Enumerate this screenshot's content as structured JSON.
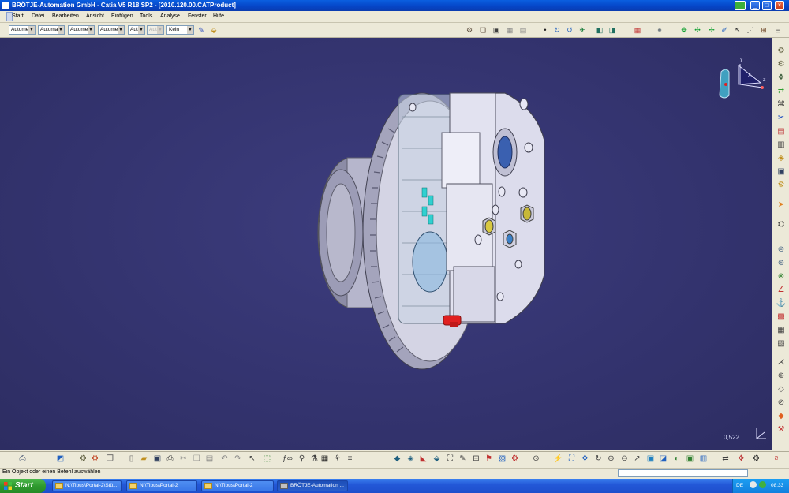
{
  "window": {
    "title": "BRÖTJE-Automation GmbH - Catia V5 R18 SP2 - [2010.120.00.CATProduct]",
    "controls": [
      "_",
      "□",
      "×"
    ]
  },
  "menu": {
    "items": [
      "Start",
      "Datei",
      "Bearbeiten",
      "Ansicht",
      "Einfügen",
      "Tools",
      "Analyse",
      "Fenster",
      "Hilfe"
    ]
  },
  "toolbar": {
    "combos": [
      "Autome",
      "Automa",
      "Autome",
      "Autome",
      "Aut",
      "Aut",
      "Kein"
    ]
  },
  "viewport": {
    "zoom": "0,522",
    "compass_labels": {
      "x": "x",
      "y": "y",
      "z": "z"
    },
    "background_color": "#33336e"
  },
  "status": {
    "message": "Ein Objekt oder einen Befehl auswählen"
  },
  "taskbar": {
    "start_label": "Start",
    "tasks": [
      "N:\\Tibus\\Portal-2\\Stü...",
      "N:\\Tibus\\Portal-2",
      "N:\\Tibus\\Portal-2",
      "BRÖTJE-Automation ..."
    ],
    "language": "DE",
    "clock": "08:33"
  },
  "icons": {
    "top_toolbar": [
      "paint-icon",
      "format-painter-icon",
      "catalog-icon",
      "snapshot-icon",
      "print-icon",
      "dot-icon",
      "rotate-icon",
      "spin-icon",
      "fly-icon",
      "view-icon",
      "tool-icon",
      "grid-icon",
      "constraint-icon",
      "move-icon",
      "compass-icon",
      "snap-icon",
      "explode-icon",
      "clash-icon",
      "measure-icon"
    ],
    "right_toolbar": [
      "product-icon",
      "component-icon",
      "existing-component-icon",
      "replace-icon",
      "graph-icon",
      "renumber-icon",
      "bom-icon",
      "part-icon",
      "publish-icon",
      "manipulation-icon",
      "snap-icon",
      "explode-icon",
      "stop-icon",
      "coincidence-icon",
      "contact-icon",
      "offset-icon",
      "angle-icon",
      "fix-icon",
      "fix-together-icon",
      "quick-constraint-icon",
      "flexible-icon",
      "change-constraint-icon",
      "reuse-pattern-icon",
      "catia-logo-icon"
    ],
    "bottom_toolbar": [
      "save-icon",
      "eraser-icon",
      "select-icon",
      "new-icon",
      "open-icon",
      "save-file-icon",
      "print-icon",
      "cut-icon",
      "copy-icon",
      "paste-icon",
      "undo-icon",
      "redo-icon",
      "whats-this-icon",
      "formula-icon",
      "knowledge-icon",
      "law-icon",
      "table-icon",
      "measure-icon",
      "cube-icon",
      "normal-view-icon",
      "fit-all-icon",
      "pan-icon",
      "rotate-icon",
      "zoom-in-icon",
      "zoom-out-icon",
      "iso-view-icon",
      "shading-icon",
      "hide-show-icon",
      "swap-icon",
      "update-icon"
    ]
  }
}
